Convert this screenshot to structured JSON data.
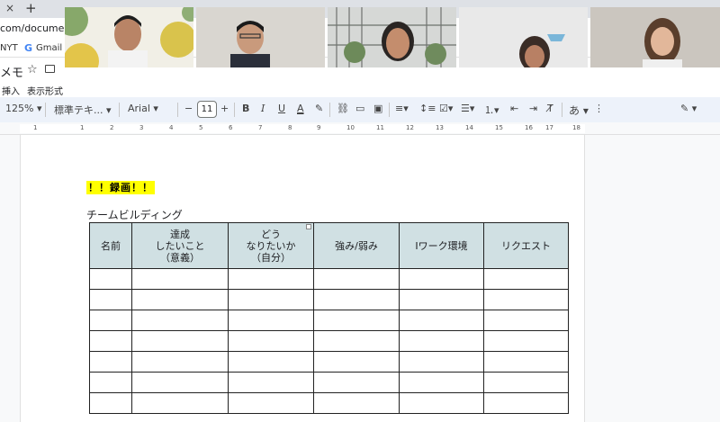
{
  "browser": {
    "tab_close_glyph": "×",
    "new_tab_glyph": "+",
    "url": "com/document/d/",
    "bookmarks": [
      {
        "label": "NYT"
      },
      {
        "label": "Gmail"
      }
    ],
    "google_g": "G"
  },
  "docs": {
    "title": "メモ",
    "menu": [
      {
        "label": "挿入"
      },
      {
        "label": "表示形式"
      }
    ]
  },
  "toolbar": {
    "zoom": "125%",
    "style": "標準テキ...",
    "font": "Arial",
    "minus": "−",
    "font_size": "11",
    "plus": "+",
    "bold": "B",
    "italic": "I",
    "underline": "U",
    "text_color": "A",
    "input_tools": "あ"
  },
  "ruler": {
    "numbers": [
      "1",
      "1",
      "2",
      "3",
      "4",
      "5",
      "6",
      "7",
      "8",
      "9",
      "10",
      "11",
      "12",
      "13",
      "14",
      "15",
      "16",
      "17",
      "18"
    ]
  },
  "document": {
    "highlight_text": "！！録画！！",
    "heading": "チームビルディング",
    "table": {
      "headers": [
        "名前",
        "達成\nしたいこと\n（意義）",
        "どう\nなりたいか\n（自分）",
        "強み/弱み",
        "Iワーク環境",
        "リクエスト"
      ],
      "empty_rows": 7
    }
  },
  "colors": {
    "table_header": "#d0e0e3",
    "highlight": "#ffff00",
    "toolbar_bg": "#edf2fa"
  }
}
